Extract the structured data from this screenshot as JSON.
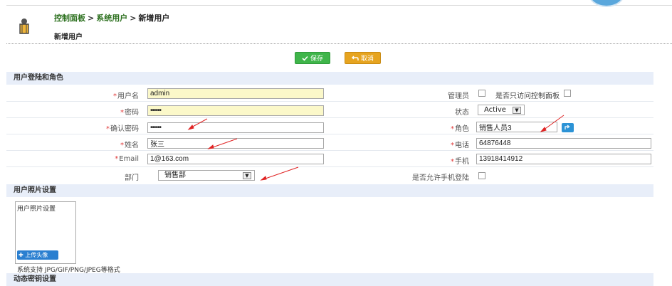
{
  "breadcrumb": {
    "items": [
      "控制面板",
      "系统用户",
      "新增用户"
    ],
    "separator": ">"
  },
  "page_title": "新增用户",
  "toolbar": {
    "save_label": "保存",
    "cancel_label": "取消",
    "save_icon": "check-icon",
    "cancel_icon": "undo-icon",
    "save_color": "#3fb54a",
    "cancel_color": "#e6a420"
  },
  "sections": {
    "login": "用户登陆和角色",
    "photo": "用户照片设置",
    "otp": "动态密钥设置"
  },
  "form": {
    "username": {
      "label": "用户名",
      "value": "admin"
    },
    "password": {
      "label": "密码",
      "value": "••••••"
    },
    "confirm_password": {
      "label": "确认密码",
      "value": "••••••"
    },
    "name": {
      "label": "姓名",
      "value": "张三"
    },
    "email": {
      "label": "Email",
      "value": "1@163.com"
    },
    "department": {
      "label": "部门",
      "value": "销售部"
    },
    "admin": {
      "label": "管理员",
      "checkbox_label": "是否只访问控制面板"
    },
    "status": {
      "label": "状态",
      "value": "Active"
    },
    "role": {
      "label": "角色",
      "value": "销售人员3"
    },
    "phone": {
      "label": "电话",
      "value": "64876448"
    },
    "mobile": {
      "label": "手机",
      "value": "13918414912"
    },
    "mobile_login": {
      "label": "是否允许手机登陆"
    }
  },
  "photo": {
    "box_text": "用户照片设置",
    "upload_label": "上传头像",
    "hint": "系统支持 JPG/GIF/PNG/JPEG等格式"
  },
  "colors": {
    "section_bg": "#e8eef9",
    "required": "#e03a3a",
    "highlight_input": "#fbf8c9",
    "annotation_arrow": "#e02424"
  }
}
